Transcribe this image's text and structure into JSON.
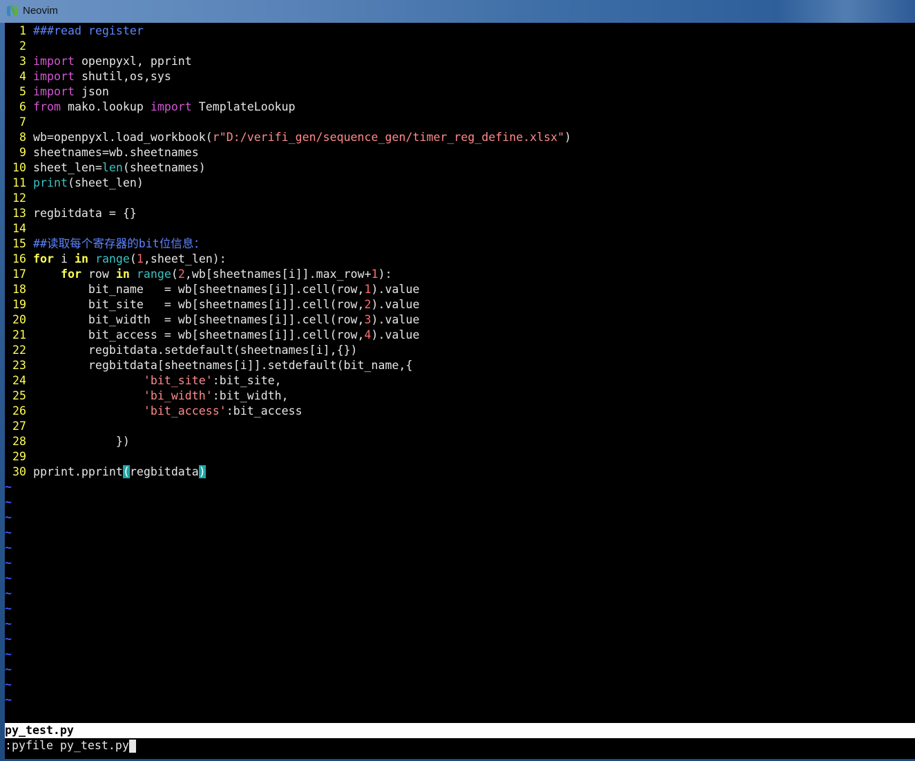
{
  "window": {
    "title": "Neovim",
    "icon": "neovim-logo-icon"
  },
  "editor": {
    "colors": {
      "background": "#000000",
      "line_number": "#ffff54",
      "keyword_import": "#d257d2",
      "keyword_control": "#ffff54",
      "builtin": "#3ac3c3",
      "number": "#ff6b6b",
      "string": "#ff8a8a",
      "comment": "#5c84ff",
      "tilde": "#3a5aff",
      "match_paren": "#1fa6a6"
    },
    "lines": [
      {
        "n": "1",
        "tokens": [
          {
            "t": "###read register",
            "c": "comment"
          }
        ]
      },
      {
        "n": "2",
        "tokens": []
      },
      {
        "n": "3",
        "tokens": [
          {
            "t": "import",
            "c": "kw-purple"
          },
          {
            "t": " openpyxl, pprint",
            "c": ""
          }
        ]
      },
      {
        "n": "4",
        "tokens": [
          {
            "t": "import",
            "c": "kw-purple"
          },
          {
            "t": " shutil,os,sys",
            "c": ""
          }
        ]
      },
      {
        "n": "5",
        "tokens": [
          {
            "t": "import",
            "c": "kw-purple"
          },
          {
            "t": " json",
            "c": ""
          }
        ]
      },
      {
        "n": "6",
        "tokens": [
          {
            "t": "from",
            "c": "kw-purple"
          },
          {
            "t": " mako.lookup ",
            "c": ""
          },
          {
            "t": "import",
            "c": "kw-purple"
          },
          {
            "t": " TemplateLookup",
            "c": ""
          }
        ]
      },
      {
        "n": "7",
        "tokens": []
      },
      {
        "n": "8",
        "tokens": [
          {
            "t": "wb=openpyxl.load_workbook(",
            "c": ""
          },
          {
            "t": "r\"D:/verifi_gen/sequence_gen/timer_reg_define.xlsx\"",
            "c": "str"
          },
          {
            "t": ")",
            "c": ""
          }
        ]
      },
      {
        "n": "9",
        "tokens": [
          {
            "t": "sheetnames=wb.sheetnames",
            "c": ""
          }
        ]
      },
      {
        "n": "10",
        "tokens": [
          {
            "t": "sheet_len=",
            "c": ""
          },
          {
            "t": "len",
            "c": "builtin"
          },
          {
            "t": "(sheetnames)",
            "c": ""
          }
        ]
      },
      {
        "n": "11",
        "tokens": [
          {
            "t": "print",
            "c": "builtin"
          },
          {
            "t": "(sheet_len)",
            "c": ""
          }
        ]
      },
      {
        "n": "12",
        "tokens": []
      },
      {
        "n": "13",
        "tokens": [
          {
            "t": "regbitdata = {}",
            "c": ""
          }
        ]
      },
      {
        "n": "14",
        "tokens": []
      },
      {
        "n": "15",
        "tokens": [
          {
            "t": "##读取每个寄存器的bit位信息：",
            "c": "comment"
          }
        ]
      },
      {
        "n": "16",
        "tokens": [
          {
            "t": "for",
            "c": "kw-yellow"
          },
          {
            "t": " i ",
            "c": ""
          },
          {
            "t": "in",
            "c": "kw-yellow"
          },
          {
            "t": " ",
            "c": ""
          },
          {
            "t": "range",
            "c": "builtin"
          },
          {
            "t": "(",
            "c": ""
          },
          {
            "t": "1",
            "c": "num"
          },
          {
            "t": ",sheet_len):",
            "c": ""
          }
        ]
      },
      {
        "n": "17",
        "tokens": [
          {
            "t": "    ",
            "c": ""
          },
          {
            "t": "for",
            "c": "kw-yellow"
          },
          {
            "t": " row ",
            "c": ""
          },
          {
            "t": "in",
            "c": "kw-yellow"
          },
          {
            "t": " ",
            "c": ""
          },
          {
            "t": "range",
            "c": "builtin"
          },
          {
            "t": "(",
            "c": ""
          },
          {
            "t": "2",
            "c": "num"
          },
          {
            "t": ",wb[sheetnames[i]].max_row+",
            "c": ""
          },
          {
            "t": "1",
            "c": "num"
          },
          {
            "t": "):",
            "c": ""
          }
        ]
      },
      {
        "n": "18",
        "tokens": [
          {
            "t": "        bit_name   = wb[sheetnames[i]].cell(row,",
            "c": ""
          },
          {
            "t": "1",
            "c": "num"
          },
          {
            "t": ").value",
            "c": ""
          }
        ]
      },
      {
        "n": "19",
        "tokens": [
          {
            "t": "        bit_site   = wb[sheetnames[i]].cell(row,",
            "c": ""
          },
          {
            "t": "2",
            "c": "num"
          },
          {
            "t": ").value",
            "c": ""
          }
        ]
      },
      {
        "n": "20",
        "tokens": [
          {
            "t": "        bit_width  = wb[sheetnames[i]].cell(row,",
            "c": ""
          },
          {
            "t": "3",
            "c": "num"
          },
          {
            "t": ").value",
            "c": ""
          }
        ]
      },
      {
        "n": "21",
        "tokens": [
          {
            "t": "        bit_access = wb[sheetnames[i]].cell(row,",
            "c": ""
          },
          {
            "t": "4",
            "c": "num"
          },
          {
            "t": ").value",
            "c": ""
          }
        ]
      },
      {
        "n": "22",
        "tokens": [
          {
            "t": "        regbitdata.setdefault(sheetnames[i],{})",
            "c": ""
          }
        ]
      },
      {
        "n": "23",
        "tokens": [
          {
            "t": "        regbitdata[sheetnames[i]].setdefault(bit_name,{",
            "c": ""
          }
        ]
      },
      {
        "n": "24",
        "tokens": [
          {
            "t": "                ",
            "c": ""
          },
          {
            "t": "'bit_site'",
            "c": "str"
          },
          {
            "t": ":bit_site,",
            "c": ""
          }
        ]
      },
      {
        "n": "25",
        "tokens": [
          {
            "t": "                ",
            "c": ""
          },
          {
            "t": "'bi_width'",
            "c": "str"
          },
          {
            "t": ":bit_width,",
            "c": ""
          }
        ]
      },
      {
        "n": "26",
        "tokens": [
          {
            "t": "                ",
            "c": ""
          },
          {
            "t": "'bit_access'",
            "c": "str"
          },
          {
            "t": ":bit_access",
            "c": ""
          }
        ]
      },
      {
        "n": "27",
        "tokens": []
      },
      {
        "n": "28",
        "tokens": [
          {
            "t": "            })",
            "c": ""
          }
        ]
      },
      {
        "n": "29",
        "tokens": []
      },
      {
        "n": "30",
        "tokens": [
          {
            "t": "pprint.pprint",
            "c": ""
          },
          {
            "t": "(",
            "c": "paren-hl"
          },
          {
            "t": "regbitdata",
            "c": ""
          },
          {
            "t": ")",
            "c": "paren-hl"
          }
        ]
      }
    ],
    "empty_line_marker": "~",
    "empty_line_count": 15
  },
  "statusline": {
    "filename": "py_test.py"
  },
  "cmdline": {
    "text": ":pyfile py_test.py"
  }
}
